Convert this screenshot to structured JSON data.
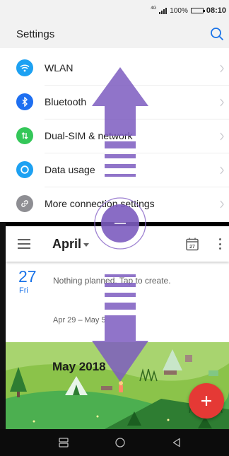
{
  "status_bar": {
    "network": "4G",
    "battery": "100%",
    "battery_level": 1.0,
    "time": "08:10"
  },
  "settings": {
    "title": "Settings",
    "search_icon": "search-icon",
    "items": [
      {
        "label": "WLAN",
        "icon": "wifi-icon",
        "color": "#1da1f2"
      },
      {
        "label": "Bluetooth",
        "icon": "bluetooth-icon",
        "color": "#1e6ff1"
      },
      {
        "label": "Dual-SIM & network",
        "icon": "dual-sim-icon",
        "color": "#34c759"
      },
      {
        "label": "Data usage",
        "icon": "data-usage-icon",
        "color": "#1da1f2"
      },
      {
        "label": "More connection settings",
        "icon": "link-icon",
        "color": "#8e8e93"
      }
    ]
  },
  "calendar": {
    "month": "April",
    "today_icon_number": "27",
    "day": {
      "number": "27",
      "weekday": "Fri",
      "message": "Nothing planned. Tap to create."
    },
    "week_range": "Apr 29 – May 5",
    "banner_month": "May 2018",
    "fab_label": "+"
  },
  "nav_bar": {
    "recents_icon": "recents-icon",
    "home_icon": "home-icon",
    "back_icon": "back-icon"
  },
  "colors": {
    "accent": "#1a73e8",
    "fab": "#e53935",
    "gesture_overlay": "#7c5cbf"
  }
}
